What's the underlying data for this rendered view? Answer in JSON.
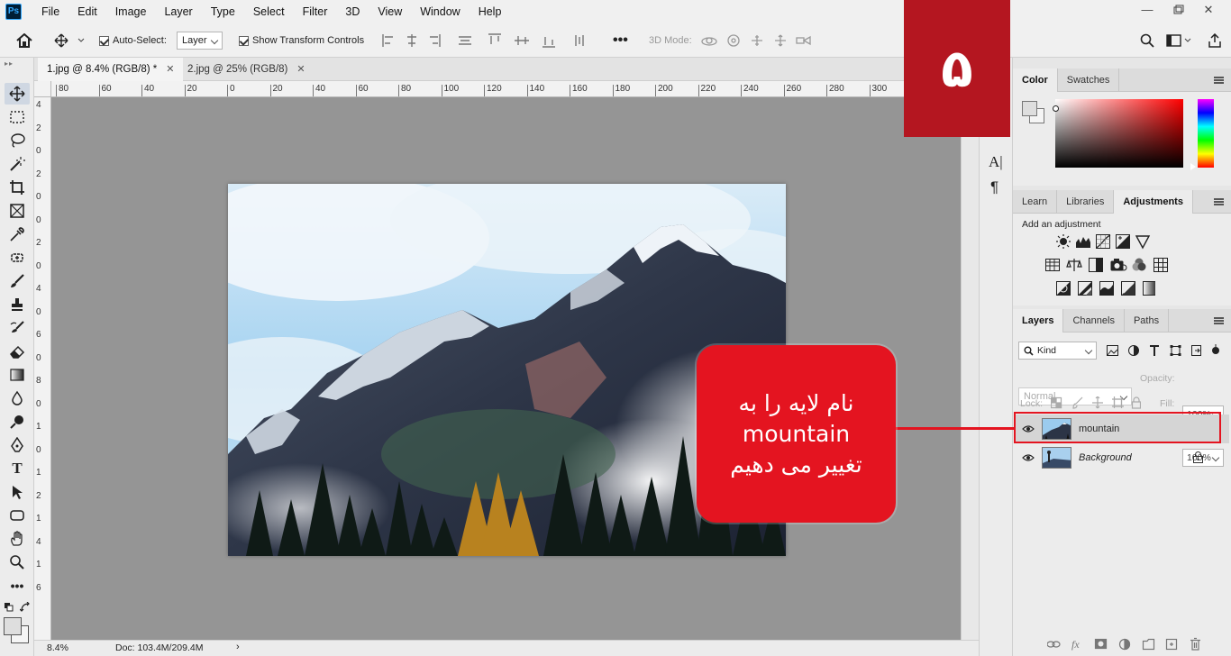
{
  "app": {
    "logo": "Ps",
    "menus": [
      "File",
      "Edit",
      "Image",
      "Layer",
      "Type",
      "Select",
      "Filter",
      "3D",
      "View",
      "Window",
      "Help"
    ]
  },
  "options": {
    "auto_select_label": "Auto-Select:",
    "auto_select_target": "Layer",
    "show_transform_label": "Show Transform Controls",
    "mode_3d_label": "3D Mode:"
  },
  "tabs": [
    {
      "label": "1.jpg @ 8.4% (RGB/8) *",
      "active": true
    },
    {
      "label": "2.jpg @ 25% (RGB/8)",
      "active": false
    }
  ],
  "rulers": {
    "h_ticks": [
      "80",
      "60",
      "40",
      "20",
      "0",
      "20",
      "40",
      "60",
      "80",
      "100",
      "120",
      "140",
      "160",
      "180",
      "200",
      "220",
      "240",
      "260",
      "280",
      "300"
    ],
    "v_ticks": [
      "4",
      "2",
      "0",
      "2",
      "0",
      "0",
      "2",
      "0",
      "4",
      "0",
      "6",
      "0",
      "8",
      "0",
      "1",
      "0",
      "1",
      "2",
      "1",
      "4",
      "1",
      "6"
    ]
  },
  "status": {
    "zoom": "8.4%",
    "doc": "Doc: 103.4M/209.4M"
  },
  "color_panel": {
    "tabs": [
      "Color",
      "Swatches"
    ],
    "active_tab": "Color",
    "hue_color": "#ff0000"
  },
  "adjustments_panel": {
    "tabs": [
      "Learn",
      "Libraries",
      "Adjustments"
    ],
    "active_tab": "Adjustments",
    "hint": "Add an adjustment",
    "icons": [
      "brightness-icon",
      "levels-icon",
      "curves-icon",
      "exposure-icon",
      "vibrance-icon",
      "hue-saturation-icon",
      "color-balance-icon",
      "black-white-icon",
      "photo-filter-icon",
      "channel-mixer-icon",
      "color-lookup-icon",
      "invert-icon",
      "posterize-icon",
      "threshold-icon",
      "selective-color-icon",
      "gradient-map-icon"
    ]
  },
  "layers_panel": {
    "tabs": [
      "Layers",
      "Channels",
      "Paths"
    ],
    "active_tab": "Layers",
    "filter_kind": "Kind",
    "blend_mode": "Normal",
    "opacity_label": "Opacity:",
    "opacity_value": "100%",
    "lock_label": "Lock:",
    "fill_label": "Fill:",
    "fill_value": "100%",
    "layers": [
      {
        "name": "mountain",
        "visible": true,
        "locked": false,
        "italic": false
      },
      {
        "name": "Background",
        "visible": true,
        "locked": true,
        "italic": true
      }
    ]
  },
  "overlay": {
    "step_number": "۵",
    "callout_lines": [
      "نام لایه را به",
      "mountain",
      "تغییر می دهیم"
    ],
    "accent": "#e41420"
  }
}
